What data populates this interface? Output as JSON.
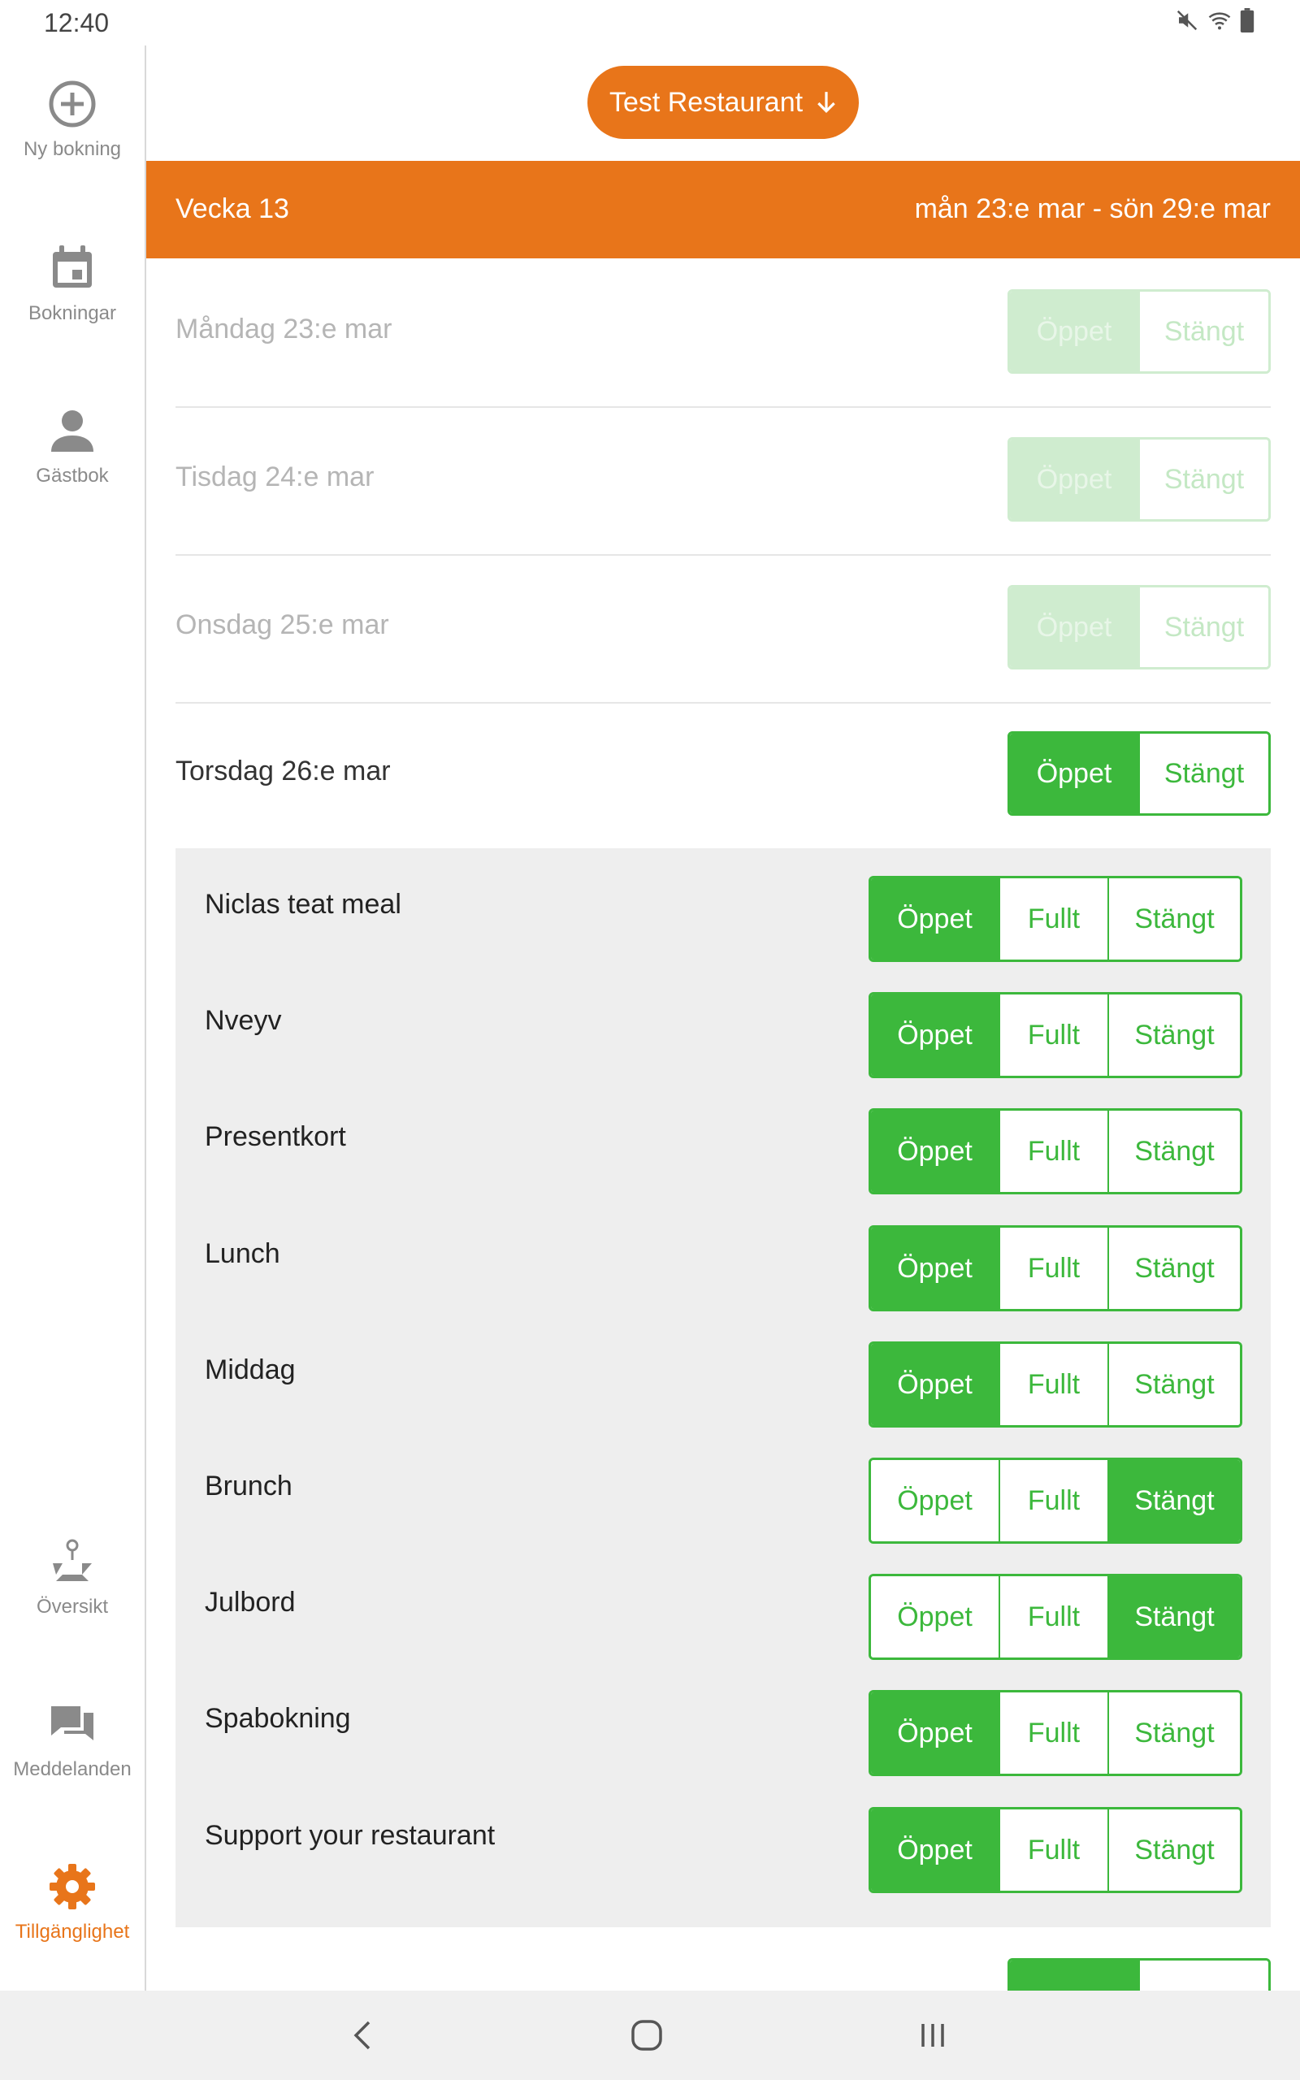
{
  "status_bar": {
    "time": "12:40"
  },
  "colors": {
    "accent": "#e8751a",
    "green": "#3cb83c",
    "muted_text": "#8a8a8a"
  },
  "sidebar": {
    "items": [
      {
        "label": "Ny bokning",
        "icon": "plus-circle-icon"
      },
      {
        "label": "Bokningar",
        "icon": "calendar-icon"
      },
      {
        "label": "Gästbok",
        "icon": "person-icon"
      },
      {
        "label": "Översikt",
        "icon": "floorplan-icon"
      },
      {
        "label": "Meddelanden",
        "icon": "chat-icon"
      },
      {
        "label": "Tillgänglighet",
        "icon": "gear-icon",
        "active": true
      }
    ]
  },
  "header": {
    "restaurant": "Test Restaurant"
  },
  "week": {
    "label": "Vecka 13",
    "range": "mån 23:e mar - sön 29:e mar"
  },
  "options": {
    "open": "Öppet",
    "full": "Fullt",
    "closed": "Stängt"
  },
  "days": [
    {
      "label": "Måndag 23:e mar",
      "selected": "open",
      "past": true
    },
    {
      "label": "Tisdag 24:e mar",
      "selected": "open",
      "past": true
    },
    {
      "label": "Onsdag 25:e mar",
      "selected": "open",
      "past": true
    },
    {
      "label": "Torsdag 26:e mar",
      "selected": "open",
      "past": false
    }
  ],
  "services": [
    {
      "label": "Niclas teat meal",
      "selected": "open"
    },
    {
      "label": "Nveyv",
      "selected": "open"
    },
    {
      "label": "Presentkort",
      "selected": "open"
    },
    {
      "label": "Lunch",
      "selected": "open"
    },
    {
      "label": "Middag",
      "selected": "open"
    },
    {
      "label": "Brunch",
      "selected": "closed"
    },
    {
      "label": "Julbord",
      "selected": "closed"
    },
    {
      "label": "Spabokning",
      "selected": "open"
    },
    {
      "label": "Support your restaurant",
      "selected": "open"
    }
  ]
}
